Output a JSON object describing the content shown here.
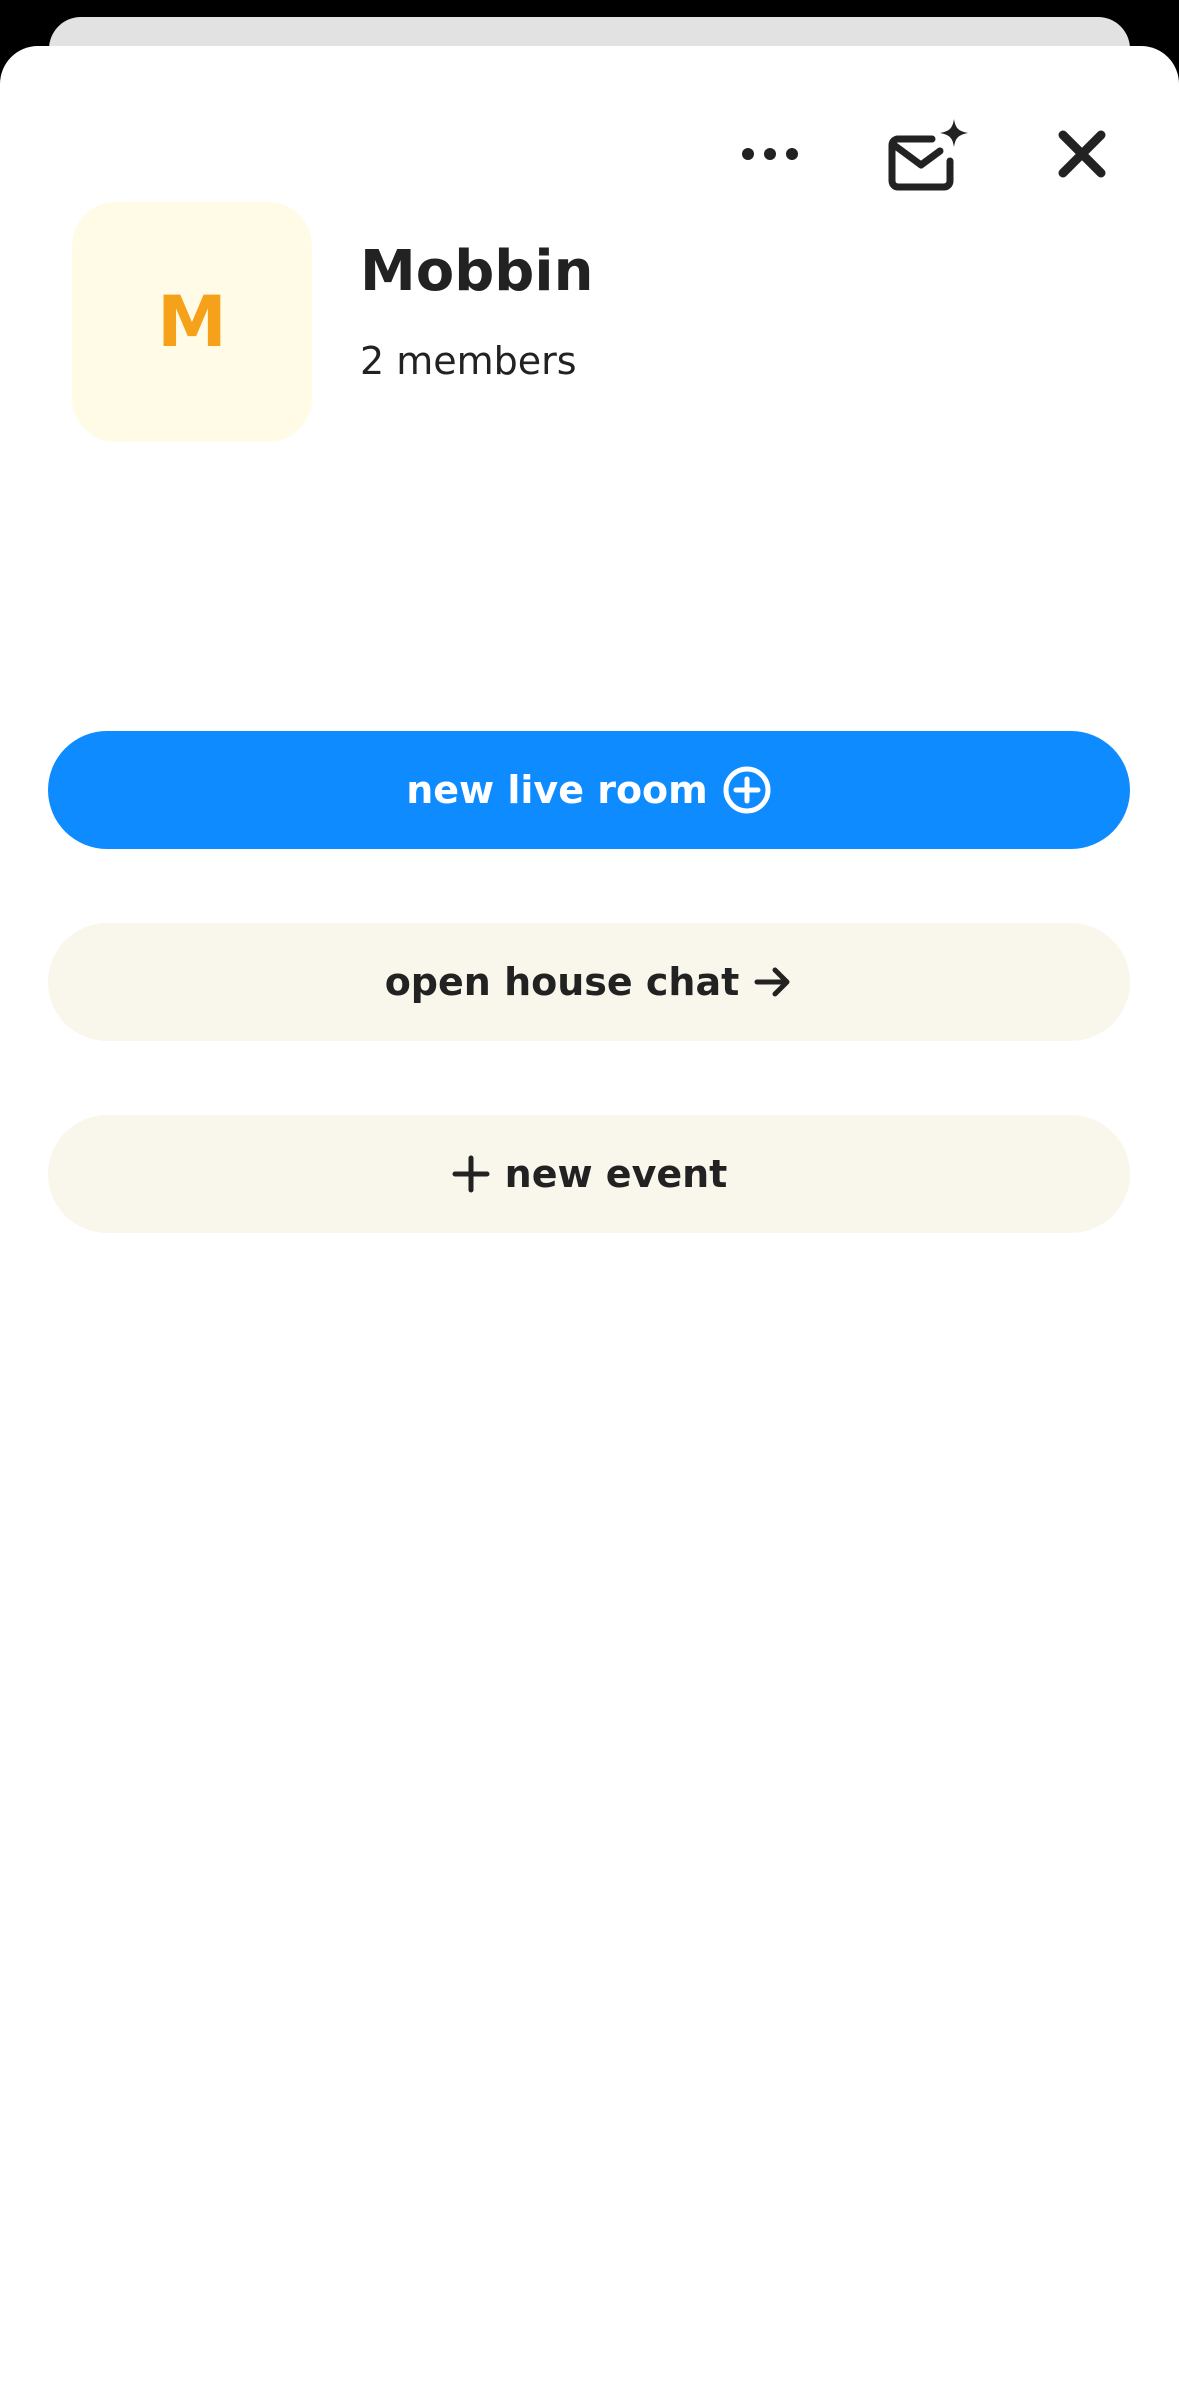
{
  "header": {
    "more_icon": "more-horizontal-icon",
    "invite_icon": "mail-sparkle-icon",
    "close_icon": "close-icon"
  },
  "club": {
    "avatar_letter": "M",
    "name": "Mobbin",
    "members": "2 members",
    "avatar_bg": "#fffbe6",
    "avatar_letter_color": "#f6a11a"
  },
  "actions": {
    "new_live_room": {
      "label": "new live room",
      "icon": "plus-circle-icon",
      "color": "#0e8cff"
    },
    "open_house_chat": {
      "label": "open house chat",
      "icon": "arrow-right-icon"
    },
    "new_event": {
      "label": "new event",
      "icon": "plus-icon"
    }
  }
}
